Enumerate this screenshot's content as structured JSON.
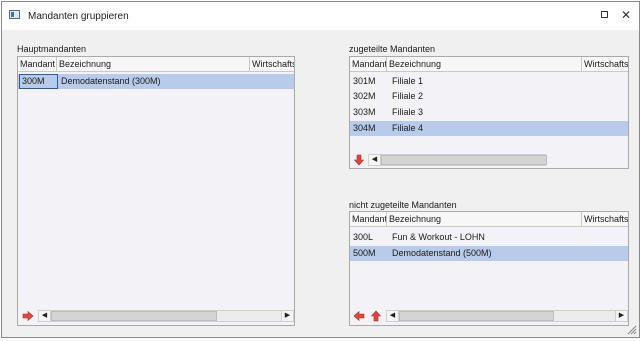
{
  "window": {
    "title": "Mandanten gruppieren",
    "maximize_icon": "maximize-icon",
    "close_icon": "close-icon",
    "close_glyph": "✕"
  },
  "hauptmandanten": {
    "label": "Hauptmandanten",
    "columns": [
      "Mandant",
      "Bezeichnung",
      "Wirtschafts"
    ],
    "rows": [
      {
        "mandant": "300M",
        "bezeichnung": "Demodatenstand (300M)",
        "selected": true
      }
    ]
  },
  "zugeteilte": {
    "label": "zugeteilte Mandanten",
    "columns": [
      "Mandant",
      "Bezeichnung",
      "Wirtschafts"
    ],
    "rows": [
      {
        "mandant": "301M",
        "bezeichnung": "Filiale 1"
      },
      {
        "mandant": "302M",
        "bezeichnung": "Filiale 2"
      },
      {
        "mandant": "303M",
        "bezeichnung": "Filiale 3"
      },
      {
        "mandant": "304M",
        "bezeichnung": "Filiale 4",
        "selected": true
      }
    ]
  },
  "nicht_zugeteilte": {
    "label": "nicht zugeteilte Mandanten",
    "columns": [
      "Mandant",
      "Bezeichnung",
      "Wirtschafts"
    ],
    "rows": [
      {
        "mandant": "300L",
        "bezeichnung": "Fun & Workout - LOHN"
      },
      {
        "mandant": "500M",
        "bezeichnung": "Demodatenstand (500M)",
        "selected": true
      }
    ]
  },
  "scroll": {
    "left_glyph": "◀",
    "right_glyph": "▶"
  },
  "colors": {
    "arrow_red": "#e0463c",
    "selection": "#b8cbea"
  }
}
